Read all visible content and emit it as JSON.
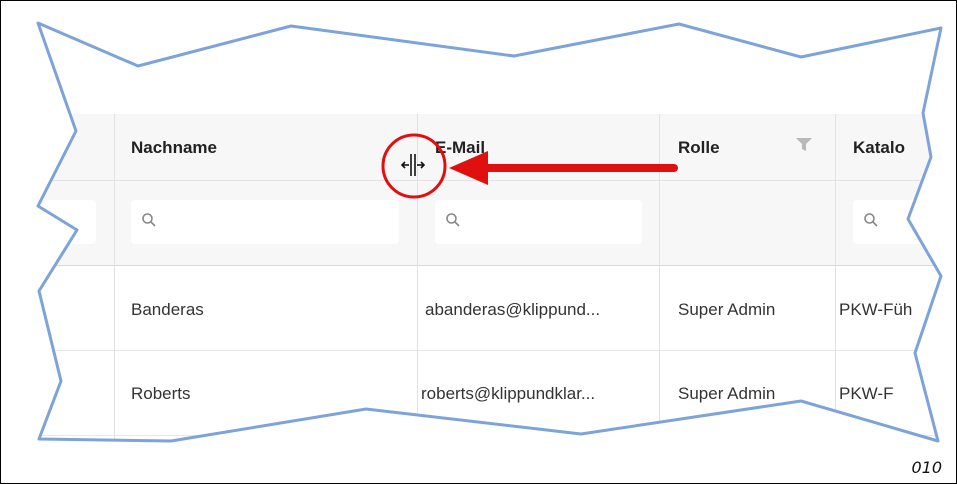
{
  "table": {
    "headers": {
      "col1": "",
      "nachname": "Nachname",
      "email": "E-Mail",
      "rolle": "Rolle",
      "katalog": "Katalo"
    },
    "rows": [
      {
        "nachname": "Banderas",
        "email": "abanderas@klippund...",
        "rolle": "Super Admin",
        "katalog": "PKW-Füh"
      },
      {
        "nachname": "Roberts",
        "email": "roberts@klippundklar...",
        "rolle": "Super Admin",
        "katalog": "PKW-F"
      }
    ]
  },
  "icons": {
    "search": "search-icon",
    "filter": "funnel-icon",
    "resize_cursor": "column-resize-cursor-icon"
  },
  "annotation": {
    "circle_color": "#e01010",
    "arrow_color": "#e01010",
    "border_color": "#7da3d8"
  },
  "footer": {
    "page_number": "010"
  }
}
